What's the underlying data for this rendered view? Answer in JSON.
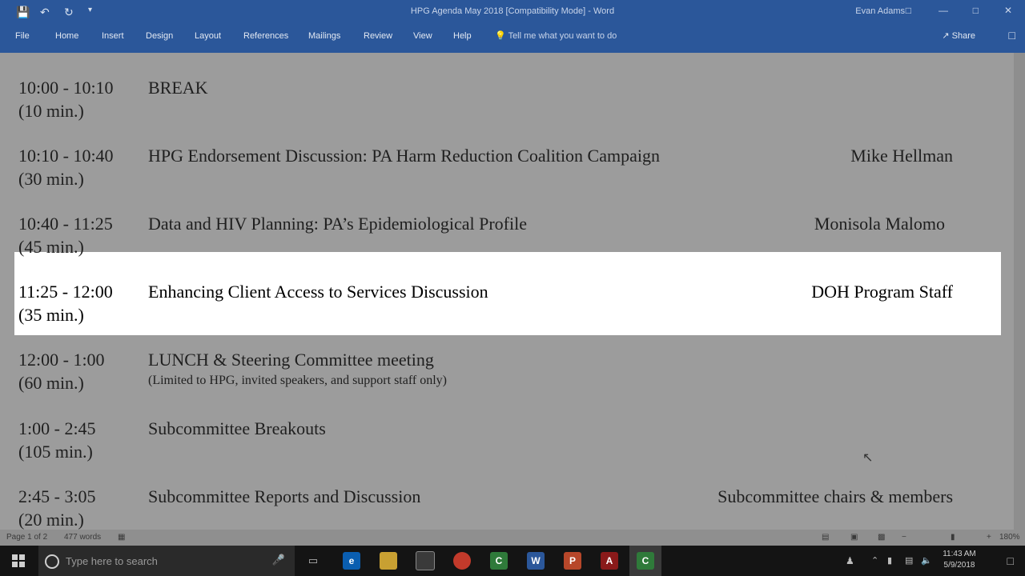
{
  "window": {
    "title": "HPG Agenda May 2018 [Compatibility Mode]  -  Word",
    "user": "Evan Adams"
  },
  "ribbon": {
    "tabs": [
      "File",
      "Home",
      "Insert",
      "Design",
      "Layout",
      "References",
      "Mailings",
      "Review",
      "View",
      "Help"
    ],
    "tell_me": "Tell me what you want to do",
    "share": "Share"
  },
  "agenda": [
    {
      "time": "10:00 - 10:10",
      "duration": "(10 min.)",
      "topic": "BREAK",
      "note": "",
      "speaker": ""
    },
    {
      "time": "10:10 - 10:40",
      "duration": "(30 min.)",
      "topic": "HPG Endorsement Discussion: PA Harm Reduction Coalition Campaign",
      "note": "",
      "speaker": "Mike Hellman"
    },
    {
      "time": "10:40 - 11:25",
      "duration": "(45 min.)",
      "topic": "Data and HIV Planning: PA’s Epidemiological Profile",
      "note": "",
      "speaker": "Monisola Malomo"
    },
    {
      "time": "11:25 - 12:00",
      "duration": "(35 min.)",
      "topic": "Enhancing Client Access to Services Discussion",
      "note": "",
      "speaker": "DOH Program Staff"
    },
    {
      "time": "12:00 - 1:00",
      "duration": "(60 min.)",
      "topic": "LUNCH & Steering Committee meeting",
      "note": "(Limited to HPG, invited speakers, and support staff only)",
      "speaker": ""
    },
    {
      "time": "1:00 - 2:45",
      "duration": "(105 min.)",
      "topic": "Subcommittee Breakouts",
      "note": "",
      "speaker": ""
    },
    {
      "time": "2:45 - 3:05",
      "duration": "(20 min.)",
      "topic": "Subcommittee Reports and Discussion",
      "note": "",
      "speaker": "Subcommittee chairs & members"
    }
  ],
  "status": {
    "page": "Page 1 of 2",
    "words": "477 words",
    "zoom": "180%"
  },
  "taskbar": {
    "search_placeholder": "Type here to search",
    "time": "11:43 AM",
    "date": "5/9/2018"
  }
}
